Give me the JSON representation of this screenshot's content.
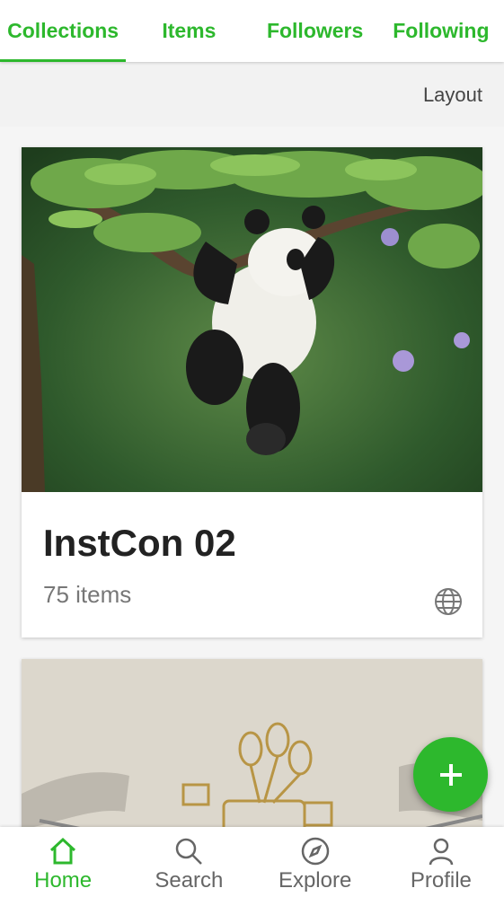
{
  "tabs": [
    {
      "label": "Collections",
      "active": true
    },
    {
      "label": "Items",
      "active": false
    },
    {
      "label": "Followers",
      "active": false
    },
    {
      "label": "Following",
      "active": false
    }
  ],
  "toolbar": {
    "layout_label": "Layout"
  },
  "collections": [
    {
      "title": "InstCon 02",
      "count": "75 items",
      "visibility_icon": "globe-icon",
      "cover": "panda hanging from tree branch"
    }
  ],
  "fab": {
    "icon": "plus-icon"
  },
  "bottom_nav": [
    {
      "label": "Home",
      "icon": "home-icon",
      "active": true
    },
    {
      "label": "Search",
      "icon": "search-icon",
      "active": false
    },
    {
      "label": "Explore",
      "icon": "compass-icon",
      "active": false
    },
    {
      "label": "Profile",
      "icon": "person-icon",
      "active": false
    }
  ],
  "colors": {
    "accent": "#2db82d",
    "background": "#f5f5f5"
  }
}
